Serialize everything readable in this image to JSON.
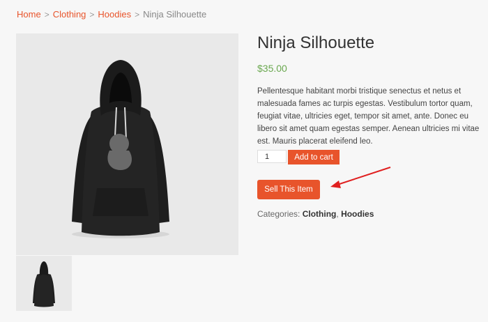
{
  "breadcrumb": {
    "home": "Home",
    "clothing": "Clothing",
    "hoodies": "Hoodies",
    "current": "Ninja Silhouette",
    "separator": ">"
  },
  "product": {
    "title": "Ninja Silhouette",
    "price": "$35.00",
    "description": "Pellentesque habitant morbi tristique senectus et netus et malesuada fames ac turpis egestas. Vestibulum tortor quam, feugiat vitae, ultricies eget, tempor sit amet, ante. Donec eu libero sit amet quam egestas semper. Aenean ultricies mi vitae est. Mauris placerat eleifend leo."
  },
  "cart": {
    "quantity": "1",
    "add_to_cart_label": "Add to cart"
  },
  "sell_button_label": "Sell This Item",
  "categories": {
    "label": "Categories:",
    "items": [
      "Clothing",
      "Hoodies"
    ],
    "separator": ","
  },
  "colors": {
    "accent": "#e8542b",
    "price": "#6aa84f",
    "annotation_arrow": "#e02020"
  }
}
